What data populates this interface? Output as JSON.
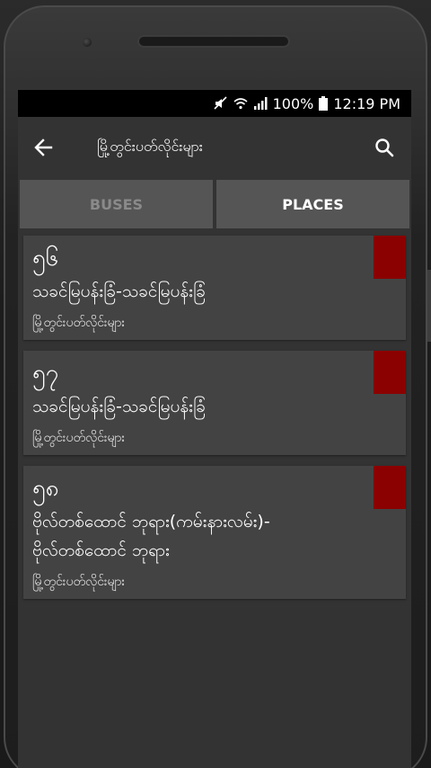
{
  "status": {
    "battery": "100%",
    "time": "12:19 PM"
  },
  "appbar": {
    "title": "မြို့တွင်းပတ်လိုင်းများ"
  },
  "tabs": [
    {
      "label": "BUSES",
      "active": false
    },
    {
      "label": "PLACES",
      "active": true
    }
  ],
  "routes": [
    {
      "number": "၅၆",
      "name": "သခင်မြပန်းခြံ-သခင်မြပန်းခြံ",
      "subtitle": "မြို့တွင်းပတ်လိုင်းများ",
      "color": "#8b0000"
    },
    {
      "number": "၅၇",
      "name": "သခင်မြပန်းခြံ-သခင်မြပန်းခြံ",
      "subtitle": "မြို့တွင်းပတ်လိုင်းများ",
      "color": "#8b0000"
    },
    {
      "number": "၅၈",
      "name": "ဗိုလ်တစ်ထောင် ဘုရား(ကမ်းနားလမ်း)-\nဗိုလ်တစ်ထောင် ဘုရား",
      "subtitle": "မြို့တွင်းပတ်လိုင်းများ",
      "color": "#8b0000"
    }
  ],
  "colors": {
    "screen_bg": "#333333",
    "card_bg": "#434343",
    "tab_bg": "#555555",
    "tag": "#8b0000"
  }
}
